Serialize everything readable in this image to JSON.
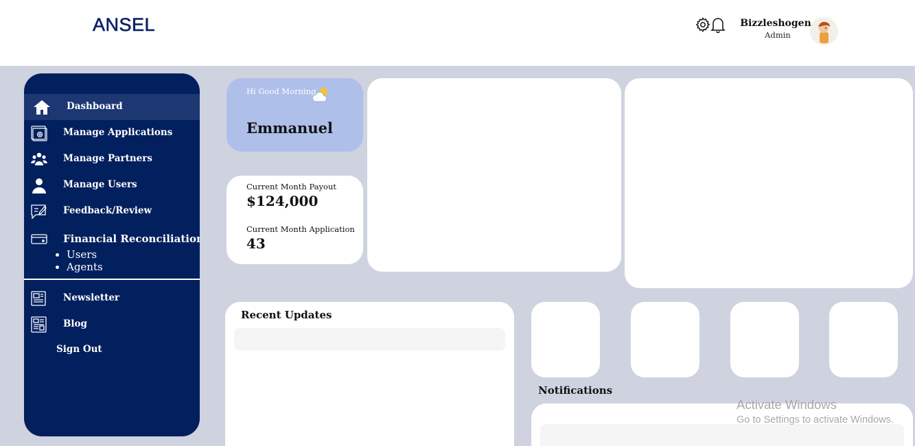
{
  "header": {
    "logo": "ANSEL",
    "user": {
      "name": "Bizzleshogen",
      "role": "Admin"
    },
    "icons": [
      "gear-icon",
      "bell-icon"
    ]
  },
  "sidebar": {
    "items": [
      {
        "label": "Dashboard",
        "icon": "home-icon",
        "active": true
      },
      {
        "label": "Manage Applications",
        "icon": "applications-icon"
      },
      {
        "label": "Manage Partners",
        "icon": "partners-icon"
      },
      {
        "label": "Manage Users",
        "icon": "user-icon"
      },
      {
        "label": "Feedback/Review",
        "icon": "feedback-icon"
      },
      {
        "label": "Financial Reconciliation",
        "icon": "card-icon",
        "children": [
          "Users",
          "Agents"
        ]
      },
      {
        "label": "Newsletter",
        "icon": "newsletter-icon"
      },
      {
        "label": "Blog",
        "icon": "blog-icon"
      },
      {
        "label": "Sign Out"
      }
    ]
  },
  "greeting": {
    "text": "Hi Good Morning",
    "name": "Emmanuel",
    "icon": "partly-cloudy-icon"
  },
  "stats": {
    "payout_label": "Current Month Payout",
    "payout_value": "$124,000",
    "applications_label": "Current Month Application",
    "applications_value": "43"
  },
  "recent_updates": {
    "title": "Recent Updates"
  },
  "notifications": {
    "title": "Notifications"
  },
  "watermark": {
    "title": "Activate Windows",
    "subtitle": "Go to Settings to activate Windows."
  },
  "colors": {
    "sidebar": "#021f5e",
    "accent": "#aebfea",
    "background": "#cfd3df",
    "logo": "#0b2165"
  }
}
